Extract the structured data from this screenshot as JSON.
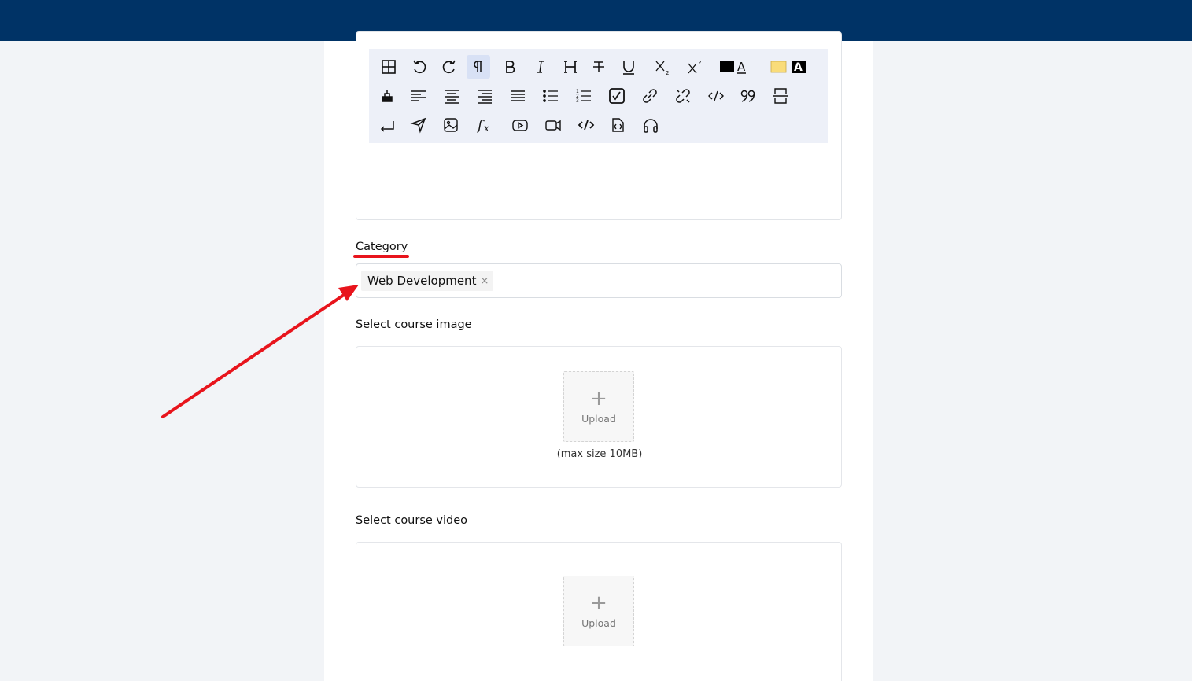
{
  "form": {
    "category_label": "Category",
    "category_tags": [
      {
        "label": "Web Development",
        "remove": "×"
      }
    ],
    "image_label": "Select course image",
    "image_upload": {
      "plus": "+",
      "label": "Upload",
      "hint": "(max size 10MB)"
    },
    "video_label": "Select course video",
    "video_upload": {
      "plus": "+",
      "label": "Upload"
    }
  },
  "toolbar": {
    "rows": [
      [
        "table-icon",
        "undo-icon",
        "redo-icon",
        "paragraph-icon",
        "bold-icon",
        "italic-icon",
        "heading-icon",
        "strikethrough-icon",
        "underline-icon",
        "subscript-icon",
        "superscript-icon",
        "font-color-icon",
        "highlight-color-icon"
      ],
      [
        "clear-format-icon",
        "align-left-icon",
        "align-center-icon",
        "align-right-icon",
        "align-justify-icon",
        "bullet-list-icon",
        "ordered-list-icon",
        "checklist-icon",
        "link-icon",
        "unlink-icon",
        "code-icon",
        "quote-icon",
        "page-break-icon"
      ],
      [
        "line-break-icon",
        "send-icon",
        "image-icon",
        "formula-icon",
        "youtube-icon",
        "video-icon",
        "code-block-icon",
        "file-code-icon",
        "audio-icon"
      ]
    ],
    "active": "paragraph-icon",
    "colors": {
      "font_color": "#000000",
      "highlight_color": "#f9dc7a"
    }
  },
  "colors": {
    "topbar": "#003366",
    "annotation": "#e8141c",
    "toolbar_bg": "#edf0f8"
  }
}
